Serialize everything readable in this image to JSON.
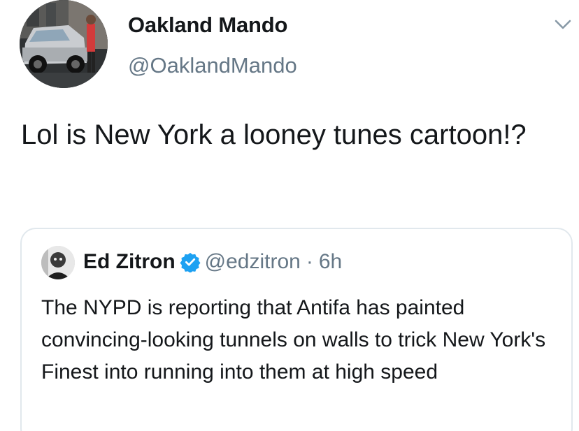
{
  "tweet": {
    "author": {
      "name": "Oakland Mando",
      "handle": "@OaklandMando"
    },
    "text": "Lol is New York a looney tunes cartoon!?",
    "quoted": {
      "author": {
        "name": "Ed Zitron",
        "handle": "@edzitron",
        "separator": "·",
        "time": "6h",
        "verified": true
      },
      "text": "The NYPD is reporting that Antifa has painted convincing-looking tunnels on walls to trick New York's Finest into running into them at high speed"
    }
  },
  "icons": {
    "menu": "chevron-down-icon",
    "verified": "verified-badge-icon"
  },
  "colors": {
    "text_primary": "#14171a",
    "text_secondary": "#657786",
    "border": "#e1e8ed",
    "verified": "#1da1f2"
  }
}
